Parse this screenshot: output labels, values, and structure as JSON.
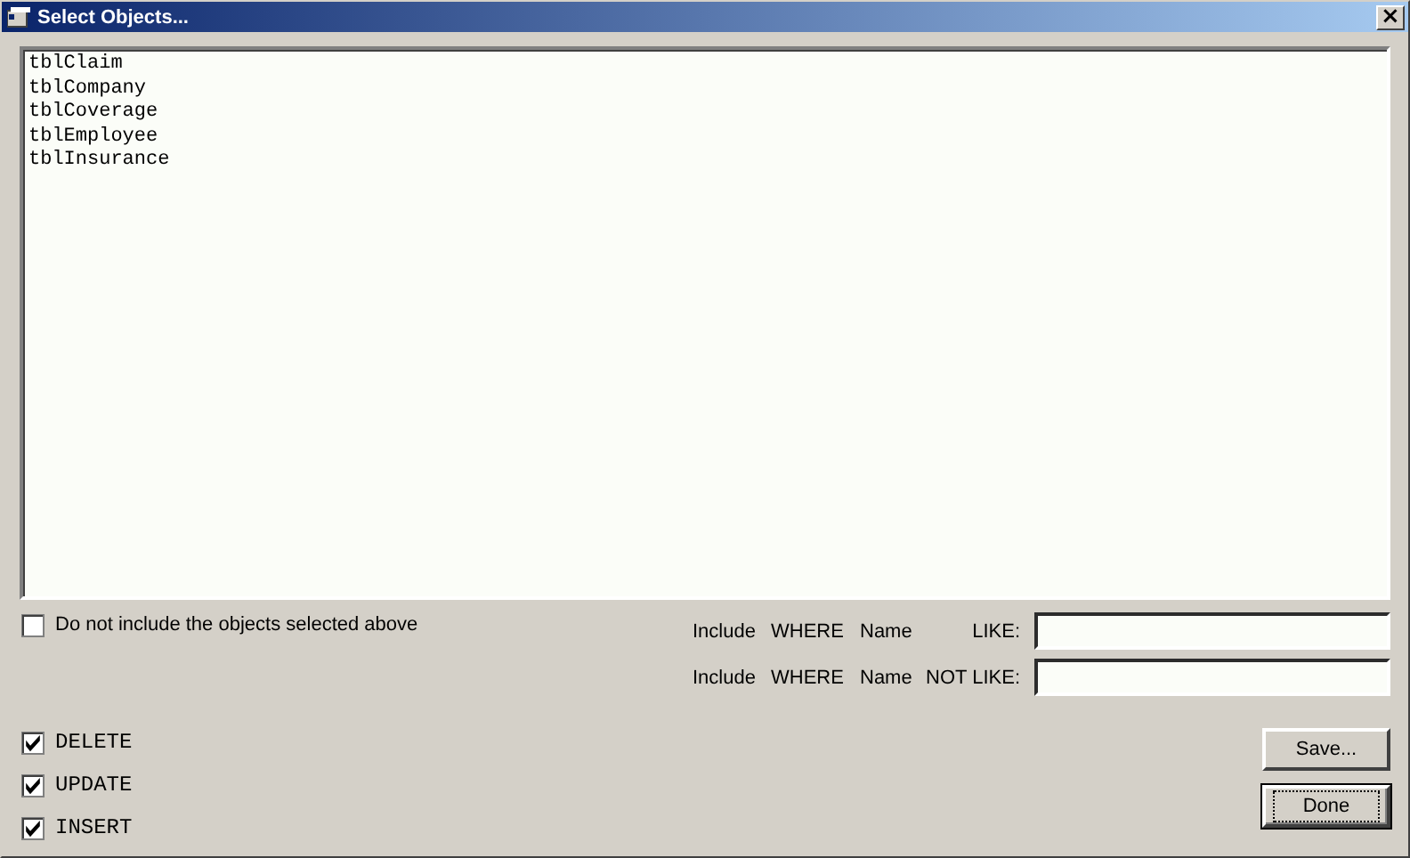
{
  "window": {
    "title": "Select Objects...",
    "close_label": "×"
  },
  "objects": [
    "tblClaim",
    "tblCompany",
    "tblCoverage",
    "tblEmployee",
    "tblInsurance"
  ],
  "exclude_option": {
    "label": "Do not include the objects selected above",
    "checked": false
  },
  "filters": [
    {
      "words": [
        "Include",
        "WHERE",
        "Name"
      ],
      "operator": "LIKE:"
    },
    {
      "words": [
        "Include",
        "WHERE",
        "Name"
      ],
      "operator": "NOT LIKE:"
    }
  ],
  "statements": [
    {
      "label": "DELETE",
      "checked": true
    },
    {
      "label": "UPDATE",
      "checked": true
    },
    {
      "label": "INSERT",
      "checked": true
    }
  ],
  "buttons": [
    {
      "label": "Save...",
      "default": false
    },
    {
      "label": "Done",
      "default": true
    }
  ]
}
